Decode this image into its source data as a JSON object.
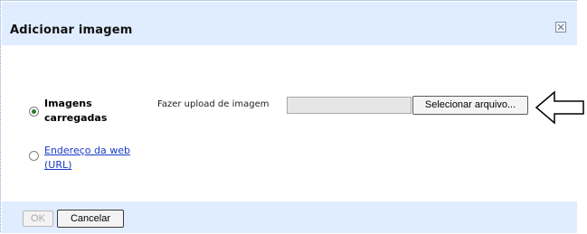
{
  "dialog": {
    "title": "Adicionar imagem",
    "close_icon": "close-icon"
  },
  "options": {
    "uploaded": {
      "line1": "Imagens",
      "line2": "carregadas",
      "selected": true
    },
    "web": {
      "line1": "Endereço da web",
      "line2": "(URL)",
      "selected": false
    }
  },
  "upload": {
    "label": "Fazer upload de imagem",
    "field_value": "",
    "button_label": "Selecionar arquivo..."
  },
  "annotation": {
    "icon": "left-arrow-icon"
  },
  "footer": {
    "ok_label": "OK",
    "cancel_label": "Cancelar"
  },
  "colors": {
    "header_bg": "#e0ecff",
    "radio_selected": "#2f7a2f",
    "link": "#1a3cc8"
  }
}
